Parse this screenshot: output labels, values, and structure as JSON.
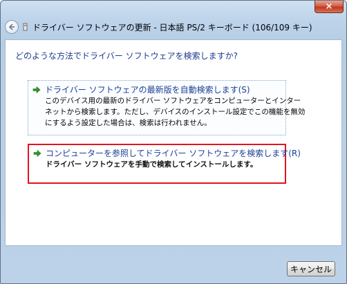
{
  "window": {
    "close_label": "×"
  },
  "header": {
    "back_icon": "back-arrow-icon",
    "wizard_icon": "keyboard-device-icon",
    "title": "ドライバー ソフトウェアの更新 - 日本語 PS/2 キーボード (106/109 キー)"
  },
  "main": {
    "question": "どのような方法でドライバー ソフトウェアを検索しますか?",
    "options": [
      {
        "icon": "green-arrow-icon",
        "title": "ドライバー ソフトウェアの最新版を自動検索します(S)",
        "description_lines": [
          "このデバイス用の最新のドライバー ソフトウェアをコンピューターとインター",
          "ネットから検索します。ただし、デバイスのインストール設定でこの機能を無効",
          "にするよう設定した場合は、検索は行われません。"
        ]
      },
      {
        "icon": "green-arrow-icon",
        "title": "コンピューターを参照してドライバー ソフトウェアを検索します(R)",
        "description_lines": [
          "ドライバー ソフトウェアを手動で検索してインストールします。"
        ],
        "highlighted": true,
        "highlight_color": "#e0131e"
      }
    ]
  },
  "footer": {
    "cancel_label": "キャンセル"
  },
  "colors": {
    "link_blue": "#1a3f95",
    "arrow_green": "#2f9a2a",
    "frame_blue": "#bcd3ea"
  }
}
